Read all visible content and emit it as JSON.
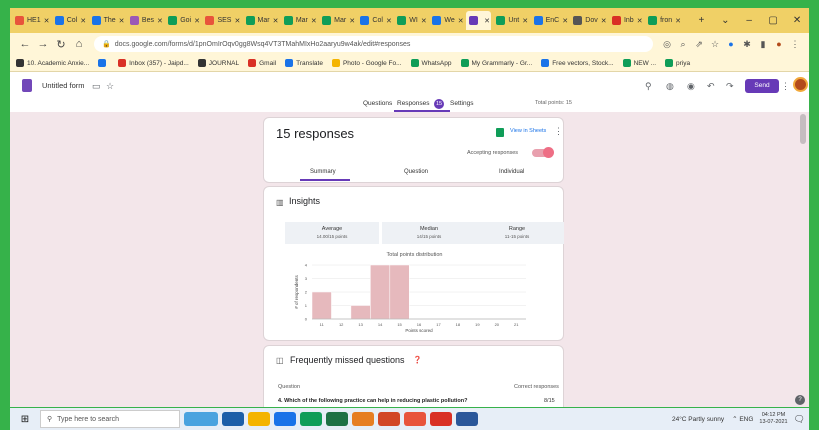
{
  "browser": {
    "tabs": [
      {
        "label": "HE1",
        "color": "#e8543b"
      },
      {
        "label": "Col",
        "color": "#1a73e8"
      },
      {
        "label": "The",
        "color": "#1a73e8"
      },
      {
        "label": "Bes",
        "color": "#9b59b6"
      },
      {
        "label": "Goi",
        "color": "#0f9d58"
      },
      {
        "label": "SES",
        "color": "#e8543b"
      },
      {
        "label": "Mar",
        "color": "#0f9d58"
      },
      {
        "label": "Mar",
        "color": "#0f9d58"
      },
      {
        "label": "Mar",
        "color": "#0f9d58"
      },
      {
        "label": "Col",
        "color": "#1a73e8"
      },
      {
        "label": "WI",
        "color": "#0f9d58"
      },
      {
        "label": "We",
        "color": "#1a73e8"
      },
      {
        "label": "",
        "color": "#673ab7",
        "active": true
      },
      {
        "label": "Unt",
        "color": "#0f9d58"
      },
      {
        "label": "EnC",
        "color": "#1a73e8"
      },
      {
        "label": "Dov",
        "color": "#555555"
      },
      {
        "label": "Inb",
        "color": "#d93025"
      },
      {
        "label": "fron",
        "color": "#0f9d58"
      }
    ],
    "new_tab": "+",
    "win_controls": [
      "⌄",
      "–",
      "▢",
      "✕"
    ],
    "url": "docs.google.com/forms/d/1pnOmIrOqv0gg8Wsq4VT3TMahMIxHo2aaryu9w4ak/edit#responses",
    "bookmarks": [
      {
        "label": "10. Academic Anxie...",
        "color": "#333333"
      },
      {
        "label": "",
        "color": "#1a73e8"
      },
      {
        "label": "Inbox (357) - Jaipd...",
        "color": "#d93025"
      },
      {
        "label": "JOURNAL",
        "color": "#333333"
      },
      {
        "label": "Gmail",
        "color": "#d93025"
      },
      {
        "label": "Translate",
        "color": "#1a73e8"
      },
      {
        "label": "Photo - Google Fo...",
        "color": "#f4b400"
      },
      {
        "label": "WhatsApp",
        "color": "#0f9d58"
      },
      {
        "label": "My Grammarly - Gr...",
        "color": "#0f9d58"
      },
      {
        "label": "Free vectors, Stock...",
        "color": "#1a73e8"
      },
      {
        "label": "NEW ...",
        "color": "#0f9d58"
      },
      {
        "label": "priya",
        "color": "#0f9d58"
      }
    ]
  },
  "form": {
    "title": "Untitled form",
    "tabs": [
      "Questions",
      "Responses",
      "Settings"
    ],
    "responses_badge": "15",
    "total_points": "Total points: 15",
    "send": "Send"
  },
  "summary": {
    "count": "15 responses",
    "sheets_link": "View in Sheets",
    "accepting": "Accepting responses",
    "subtabs": [
      "Summary",
      "Question",
      "Individual"
    ]
  },
  "insights": {
    "title": "Insights",
    "stats": [
      {
        "label": "Average",
        "value": "14.00/15 points"
      },
      {
        "label": "Median",
        "value": "14/15 points"
      },
      {
        "label": "Range",
        "value": "11-15 points"
      }
    ],
    "chart_title": "Total points distribution",
    "ylabel": "# of respondents",
    "xlabel": "Points scored"
  },
  "chart_data": {
    "type": "bar",
    "title": "Total points distribution",
    "xlabel": "Points scored",
    "ylabel": "# of respondents",
    "categories": [
      "11",
      "12",
      "13",
      "14",
      "15",
      "16",
      "17",
      "18",
      "19",
      "20",
      "21"
    ],
    "values": [
      2,
      0,
      1,
      4,
      4,
      0,
      0,
      0,
      0,
      0,
      0
    ],
    "ylim": [
      0,
      4
    ],
    "color": "#e6b9bd"
  },
  "missed": {
    "title": "Frequently missed questions",
    "col_question": "Question",
    "col_correct": "Correct responses",
    "rows": [
      {
        "q": "4. Which of the following practice can help in reducing plastic pollution?",
        "v": "8/15"
      }
    ]
  },
  "taskbar": {
    "search": "Type here to search",
    "weather": "24°C  Partly sunny",
    "tray": "⌃  ENG",
    "time": "04:12 PM",
    "date": "13-07-2021",
    "apps": [
      "#4aa3df",
      "#1d5fa8",
      "#f4b400",
      "#1a73e8",
      "#0f9d58",
      "#1e7145",
      "#e67e22",
      "#d24726",
      "#e8543b",
      "#d93025",
      "#2b579a"
    ]
  }
}
